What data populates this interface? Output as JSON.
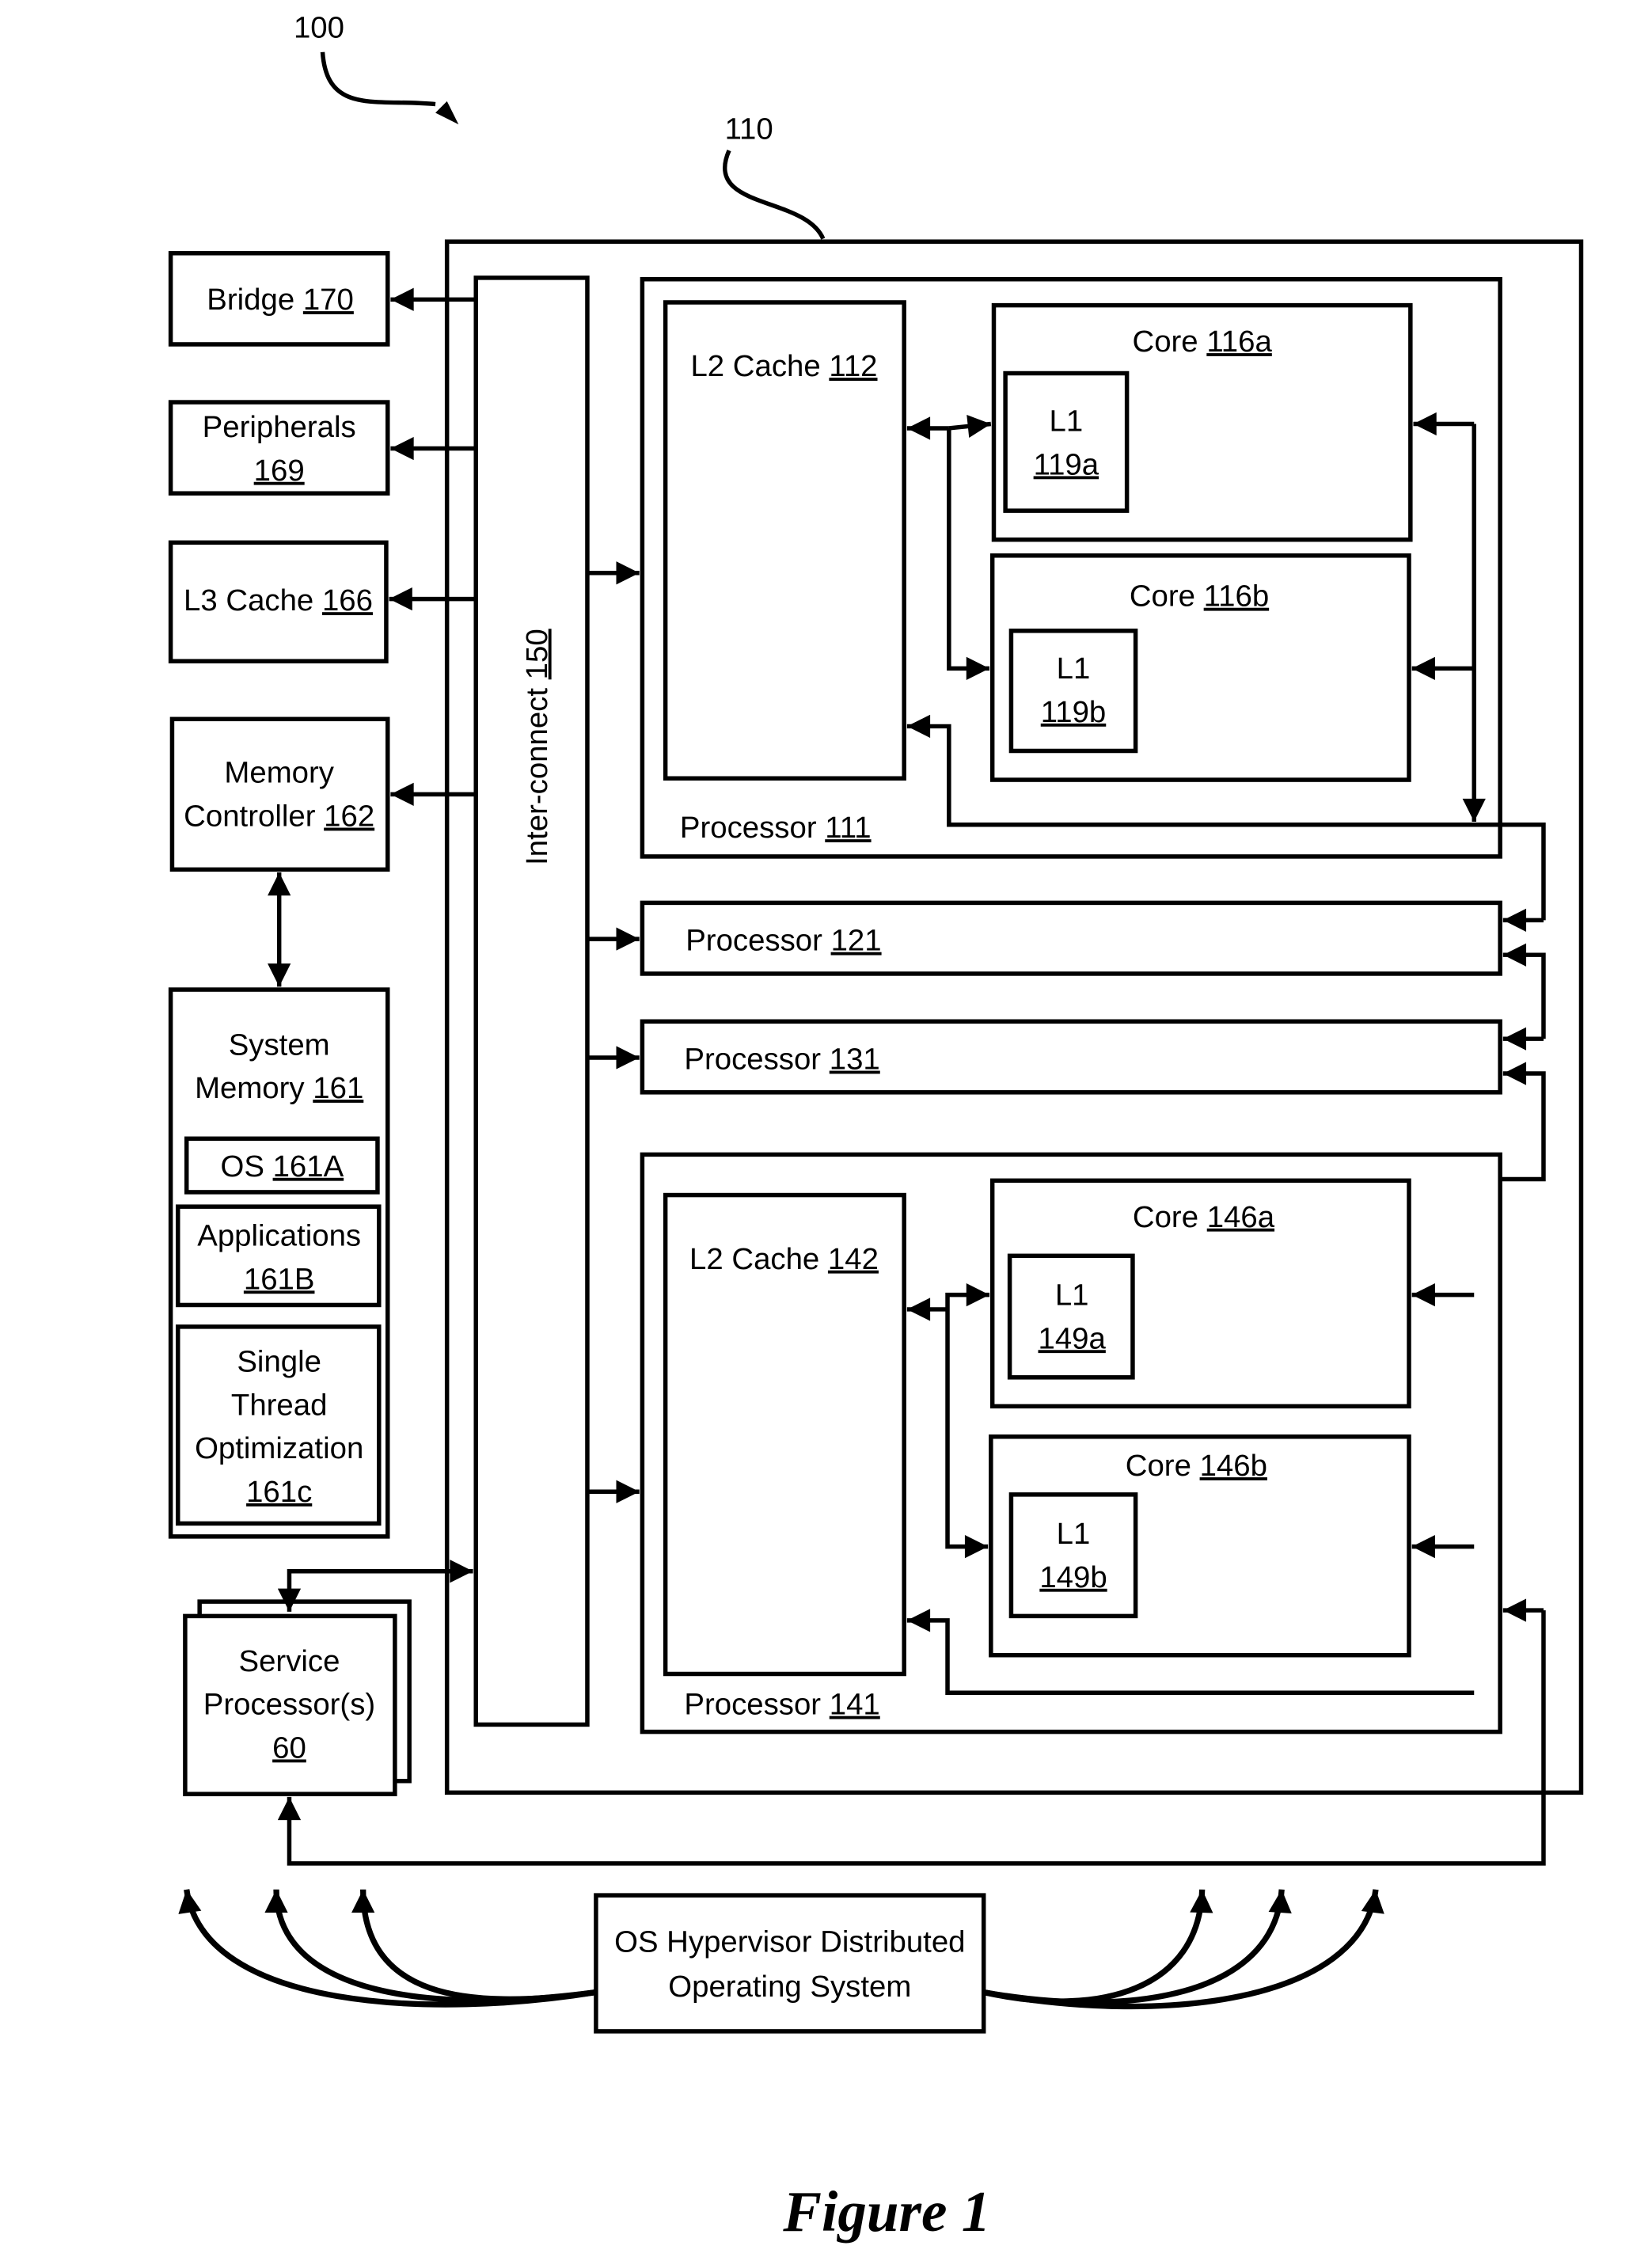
{
  "figure": {
    "caption": "Figure 1",
    "system_ref": "100",
    "node_ref": "110"
  },
  "left": {
    "bridge": {
      "name": "Bridge",
      "ref": "170"
    },
    "peripherals": {
      "name": "Peripherals",
      "ref": "169"
    },
    "l3_cache": {
      "name": "L3 Cache",
      "ref": "166"
    },
    "memory_controller": {
      "line1": "Memory",
      "line2": "Controller",
      "ref": "162"
    },
    "system_memory": {
      "line1": "System",
      "line2": "Memory",
      "ref": "161",
      "os": {
        "name": "OS",
        "ref": "161A"
      },
      "applications": {
        "name": "Applications",
        "ref": "161B"
      },
      "sto": {
        "line1": "Single",
        "line2": "Thread",
        "line3": "Optimization",
        "ref": "161c"
      }
    },
    "service_processor": {
      "line1": "Service",
      "line2": "Processor(s)",
      "ref": "60"
    }
  },
  "interconnect": {
    "name": "Inter-connect",
    "ref": "150"
  },
  "processors": {
    "p111": {
      "name": "Processor",
      "ref": "111",
      "l2": {
        "name": "L2 Cache",
        "ref": "112"
      },
      "core_a": {
        "name": "Core",
        "ref": "116a",
        "l1_name": "L1",
        "l1_ref": "119a"
      },
      "core_b": {
        "name": "Core",
        "ref": "116b",
        "l1_name": "L1",
        "l1_ref": "119b"
      }
    },
    "p121": {
      "name": "Processor",
      "ref": "121"
    },
    "p131": {
      "name": "Processor",
      "ref": "131"
    },
    "p141": {
      "name": "Processor",
      "ref": "141",
      "l2": {
        "name": "L2 Cache",
        "ref": "142"
      },
      "core_a": {
        "name": "Core",
        "ref": "146a",
        "l1_name": "L1",
        "l1_ref": "149a"
      },
      "core_b": {
        "name": "Core",
        "ref": "146b",
        "l1_name": "L1",
        "l1_ref": "149b"
      }
    }
  },
  "hypervisor": {
    "line1": "OS Hypervisor Distributed",
    "line2": "Operating System"
  }
}
